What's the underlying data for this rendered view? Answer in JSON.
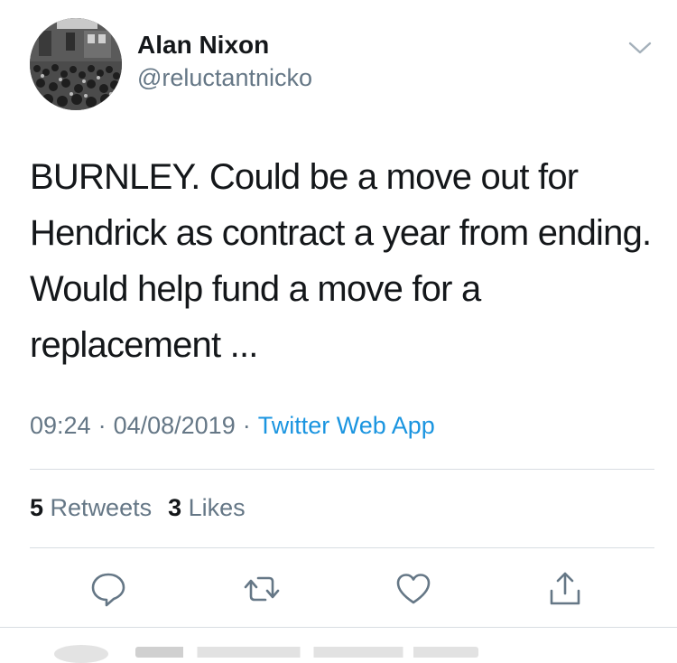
{
  "tweet": {
    "author": {
      "display_name": "Alan Nixon",
      "handle": "@reluctantnicko"
    },
    "text": "BURNLEY. Could be a move out for Hendrick as contract a year from ending. Would help fund a move for a replacement ...",
    "time": "09:24",
    "date": "04/08/2019",
    "separator": "·",
    "source": "Twitter Web App",
    "retweets_count": "5",
    "retweets_label": "Retweets",
    "likes_count": "3",
    "likes_label": "Likes"
  },
  "icons": {
    "caret": "chevron-down-icon",
    "reply": "reply-icon",
    "retweet": "retweet-icon",
    "like": "heart-icon",
    "share": "share-icon"
  },
  "colors": {
    "text": "#14171a",
    "secondary": "#657786",
    "link": "#1b95e0",
    "divider": "#d8dde2"
  }
}
